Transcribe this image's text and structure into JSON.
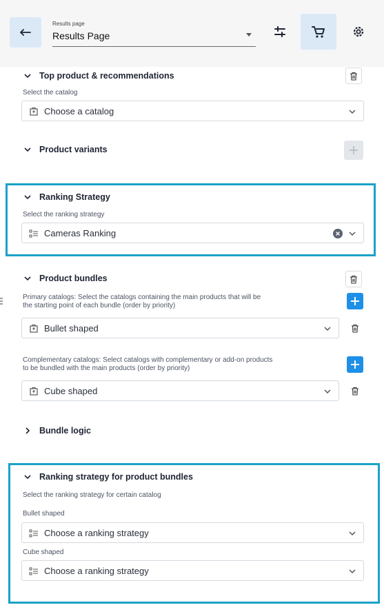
{
  "header": {
    "page_select_label": "Results page",
    "page_select_value": "Results Page"
  },
  "sections": {
    "top_product": {
      "title": "Top product & recommendations",
      "field_label": "Select the catalog",
      "placeholder": "Choose a catalog"
    },
    "variants": {
      "title": "Product variants"
    },
    "ranking": {
      "title": "Ranking Strategy",
      "field_label": "Select the ranking strategy",
      "value": "Cameras Ranking"
    },
    "bundles": {
      "title": "Product bundles",
      "primary_label_1": "Primary catalogs: Select the catalogs containing the main products that will be",
      "primary_label_2": "the starting point of each bundle (order by priority)",
      "primary_value": "Bullet shaped",
      "complementary_label_1": "Complementary catalogs: Select catalogs with complementary or add-on products",
      "complementary_label_2": "to be bundled with the main products (order by priority)",
      "complementary_value": "Cube shaped"
    },
    "bundle_logic": {
      "title": "Bundle logic"
    },
    "bundle_ranking": {
      "title": "Ranking strategy for product bundles",
      "field_label": "Select the ranking strategy for certain catalog",
      "catalog_1": "Bullet shaped",
      "placeholder_1": "Choose a ranking strategy",
      "catalog_2": "Cube shaped",
      "placeholder_2": "Choose a ranking strategy"
    }
  },
  "colors": {
    "accent_blue": "#1e90e8",
    "highlight_border": "#1aa2c8",
    "active_bg": "#dbe9f7"
  },
  "icons": [
    "arrow-left-icon",
    "chevron-down-icon",
    "filter-sliders-icon",
    "cart-icon",
    "gear-icon",
    "trash-icon",
    "plus-icon",
    "catalog-icon",
    "ranking-list-icon",
    "clear-icon",
    "chevron-right-icon"
  ]
}
